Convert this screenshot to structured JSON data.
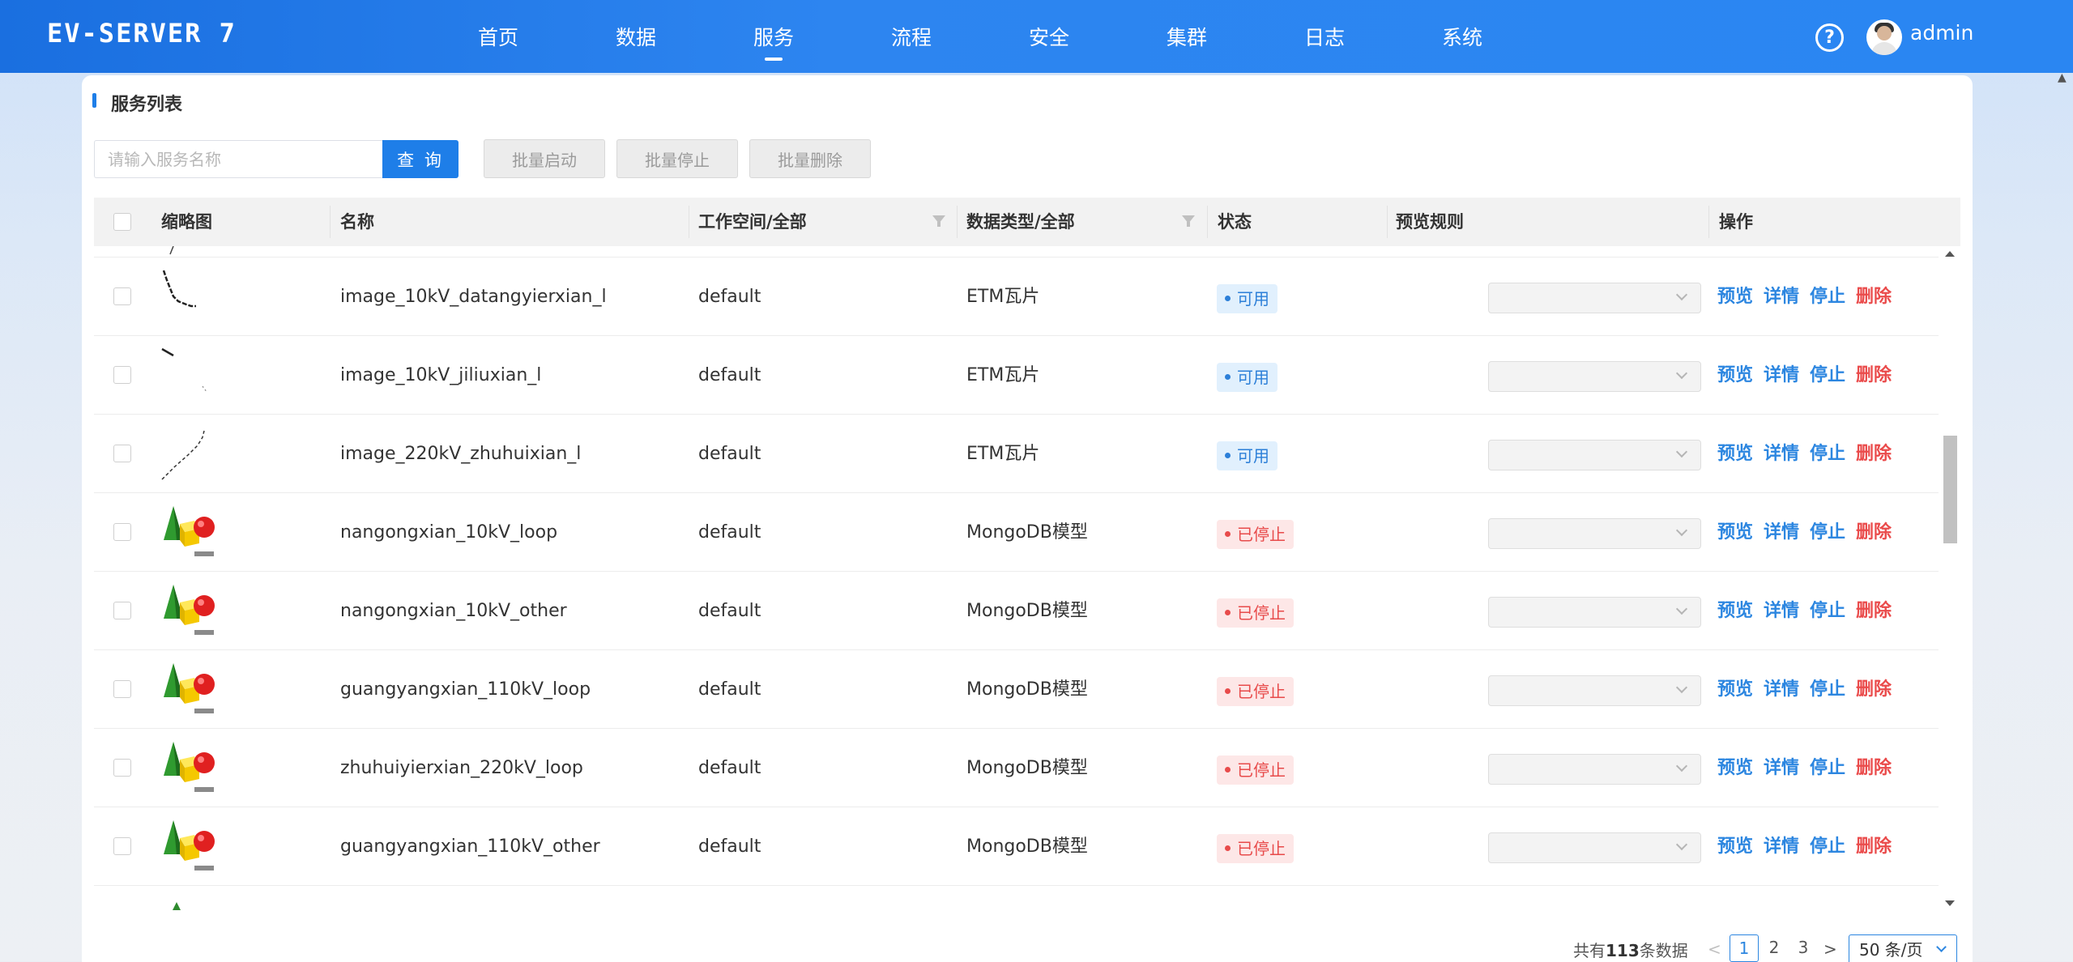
{
  "app": {
    "logo": "EV-SERVER 7"
  },
  "nav": {
    "items": [
      {
        "label": "首页",
        "active": false
      },
      {
        "label": "数据",
        "active": false
      },
      {
        "label": "服务",
        "active": true
      },
      {
        "label": "流程",
        "active": false
      },
      {
        "label": "安全",
        "active": false
      },
      {
        "label": "集群",
        "active": false
      },
      {
        "label": "日志",
        "active": false
      },
      {
        "label": "系统",
        "active": false
      }
    ],
    "help_icon": "?",
    "username": "admin"
  },
  "panel": {
    "title": "服务列表",
    "search_placeholder": "请输入服务名称",
    "search_label": "查 询",
    "batch_start": "批量启动",
    "batch_stop": "批量停止",
    "batch_delete": "批量删除"
  },
  "table": {
    "headers": {
      "thumb": "缩略图",
      "name": "名称",
      "workspace": "工作空间/全部",
      "datatype": "数据类型/全部",
      "status": "状态",
      "rule": "预览规则",
      "ops": "操作"
    },
    "ops": {
      "preview": "预览",
      "detail": "详情",
      "stop": "停止",
      "delete": "删除"
    },
    "rows": [
      {
        "thumb": "line-thumbnail-a",
        "name": "image_10kV_datangyierxian_l",
        "workspace": "default",
        "datatype": "ETM瓦片",
        "status": "可用",
        "state": "ok"
      },
      {
        "thumb": "line-thumbnail-b",
        "name": "image_10kV_jiliuxian_l",
        "workspace": "default",
        "datatype": "ETM瓦片",
        "status": "可用",
        "state": "ok"
      },
      {
        "thumb": "line-thumbnail-c",
        "name": "image_220kV_zhuhuixian_l",
        "workspace": "default",
        "datatype": "ETM瓦片",
        "status": "可用",
        "state": "ok"
      },
      {
        "thumb": "model-thumbnail",
        "name": "nangongxian_10kV_loop",
        "workspace": "default",
        "datatype": "MongoDB模型",
        "status": "已停止",
        "state": "stop"
      },
      {
        "thumb": "model-thumbnail",
        "name": "nangongxian_10kV_other",
        "workspace": "default",
        "datatype": "MongoDB模型",
        "status": "已停止",
        "state": "stop"
      },
      {
        "thumb": "model-thumbnail",
        "name": "guangyangxian_110kV_loop",
        "workspace": "default",
        "datatype": "MongoDB模型",
        "status": "已停止",
        "state": "stop"
      },
      {
        "thumb": "model-thumbnail",
        "name": "zhuhuiyierxian_220kV_loop",
        "workspace": "default",
        "datatype": "MongoDB模型",
        "status": "已停止",
        "state": "stop"
      },
      {
        "thumb": "model-thumbnail",
        "name": "guangyangxian_110kV_other",
        "workspace": "default",
        "datatype": "MongoDB模型",
        "status": "已停止",
        "state": "stop"
      }
    ]
  },
  "pagination": {
    "total_prefix": "共有",
    "total": "113",
    "total_suffix": "条数据",
    "pages": [
      "1",
      "2",
      "3"
    ],
    "current": "1",
    "page_size": "50 条/页"
  },
  "colors": {
    "accent": "#1e7ee8",
    "ok": "#2c7fd8",
    "stop": "#e84b4b",
    "link": "#2c86e0"
  }
}
